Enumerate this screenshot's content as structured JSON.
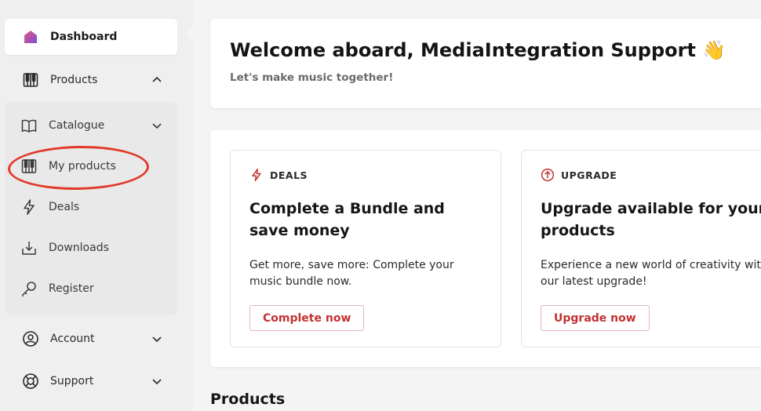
{
  "sidebar": {
    "dashboard": {
      "label": "Dashboard",
      "icon": "home-icon"
    },
    "products": {
      "label": "Products",
      "icon": "keyboard-icon"
    },
    "sub": [
      {
        "label": "Catalogue",
        "icon": "book-icon"
      },
      {
        "label": "My products",
        "icon": "keyboard-icon"
      },
      {
        "label": "Deals",
        "icon": "lightning-icon"
      },
      {
        "label": "Downloads",
        "icon": "download-icon"
      },
      {
        "label": "Register",
        "icon": "key-icon"
      }
    ],
    "account": {
      "label": "Account",
      "icon": "user-circle-icon"
    },
    "support": {
      "label": "Support",
      "icon": "lifebuoy-icon"
    }
  },
  "welcome": {
    "title": "Welcome aboard, MediaIntegration Support 👋",
    "subtitle": "Let's make music together!"
  },
  "cards": [
    {
      "tag": "DEALS",
      "icon": "lightning-icon",
      "heading": "Complete a Bundle and save money",
      "description": "Get more, save more: Complete your music bundle now.",
      "button": "Complete now"
    },
    {
      "tag": "UPGRADE",
      "icon": "arrow-up-circle-icon",
      "heading": "Upgrade available for your products",
      "description": "Experience a new world of creativity with our latest upgrade!",
      "button": "Upgrade now"
    }
  ],
  "products_heading": "Products",
  "colors": {
    "accent": "#c23131",
    "highlight_circle": "#e23a2a",
    "dashboard_icon": "#d94f7a"
  }
}
